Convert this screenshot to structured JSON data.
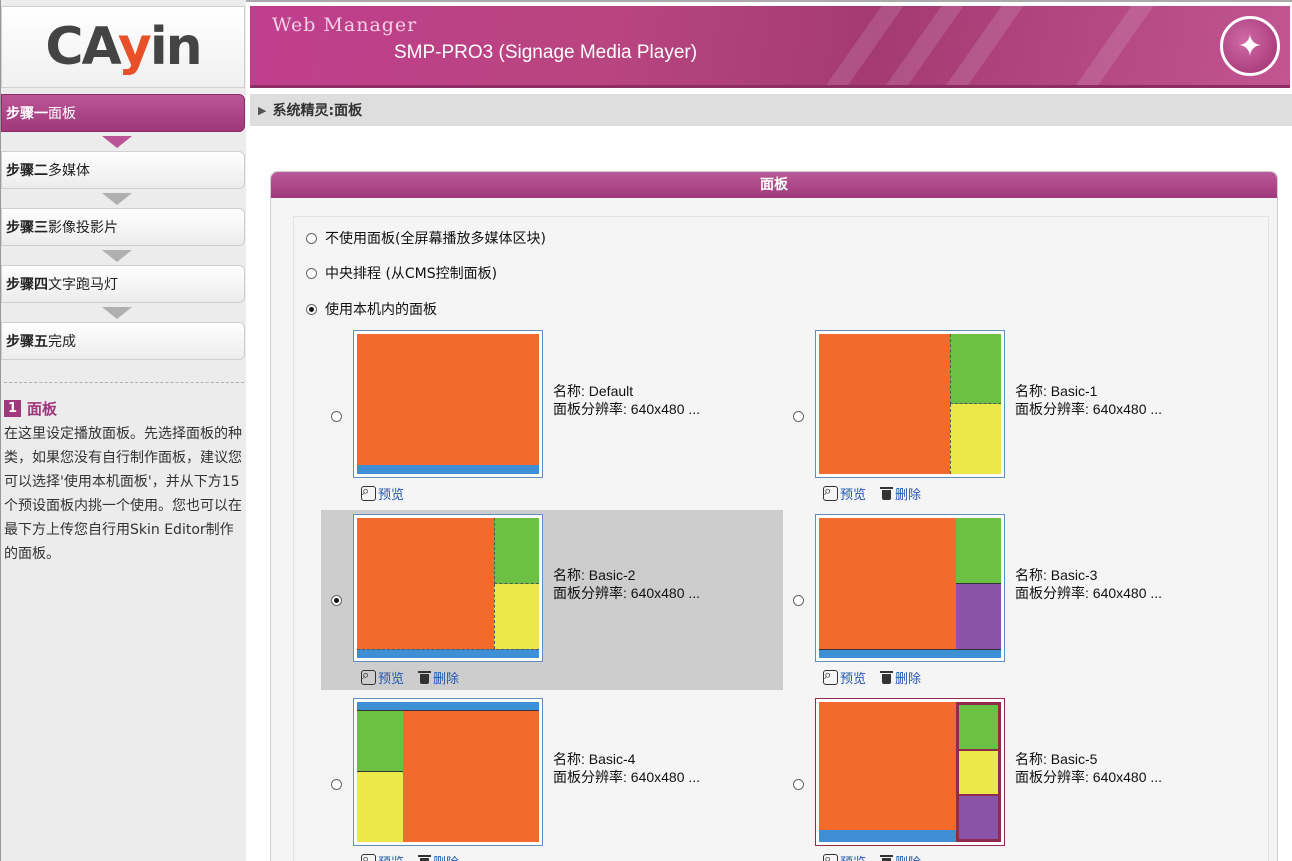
{
  "logo": {
    "text_left": "CA",
    "text_mid": "y",
    "text_right": "in"
  },
  "header": {
    "app": "Web Manager",
    "model": "SMP-PRO3 (Signage Media Player)",
    "icon": "star-burst-icon"
  },
  "steps": [
    {
      "prefix": "步骤一",
      "label": "面板"
    },
    {
      "prefix": "步骤二",
      "label": "多媒体"
    },
    {
      "prefix": "步骤三",
      "label": "影像投影片"
    },
    {
      "prefix": "步骤四",
      "label": "文字跑马灯"
    },
    {
      "prefix": "步骤五",
      "label": "完成"
    }
  ],
  "help": {
    "number": "1",
    "title": "面板",
    "text": "在这里设定播放面板。先选择面板的种类，如果您没有自行制作面板，建议您可以选择'使用本机面板'，并从下方15个预设面板内挑一个使用。您也可以在最下方上传您自行用Skin Editor制作的面板。"
  },
  "breadcrumb": "系统精灵:面板",
  "panel": {
    "title": "面板",
    "options": [
      {
        "label": "不使用面板(全屏幕播放多媒体区块)",
        "checked": false
      },
      {
        "label": "中央排程 (从CMS控制面板)",
        "checked": false
      },
      {
        "label": "使用本机内的面板",
        "checked": true
      }
    ]
  },
  "skin_labels": {
    "name_prefix": "名称: ",
    "res_prefix": "面板分辨率: ",
    "preview": "预览",
    "delete": "删除"
  },
  "skins": [
    {
      "name": "Default",
      "res": "640x480 ...",
      "selected": false,
      "deletable": false
    },
    {
      "name": "Basic-1",
      "res": "640x480 ...",
      "selected": false,
      "deletable": true
    },
    {
      "name": "Basic-2",
      "res": "640x480 ...",
      "selected": true,
      "deletable": true
    },
    {
      "name": "Basic-3",
      "res": "640x480 ...",
      "selected": false,
      "deletable": true
    },
    {
      "name": "Basic-4",
      "res": "640x480 ...",
      "selected": false,
      "deletable": true
    },
    {
      "name": "Basic-5",
      "res": "640x480 ...",
      "selected": false,
      "deletable": true
    }
  ],
  "colors": {
    "brand": "#a0387b",
    "link": "#1f56b3",
    "zone_main": "#f26a2c",
    "zone_ticker": "#3e8fd4",
    "zone_a": "#6cc043",
    "zone_b": "#ebe84a",
    "zone_c": "#8a53a8"
  }
}
